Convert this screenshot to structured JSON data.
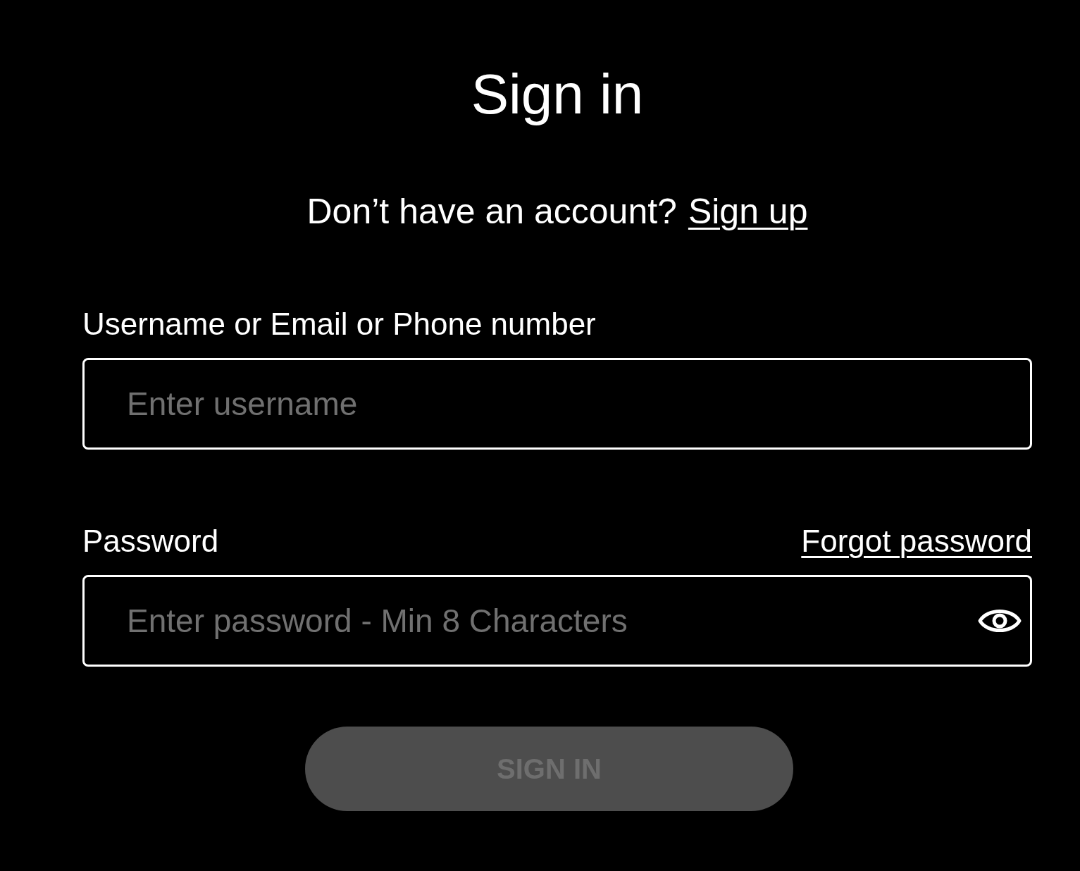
{
  "title": "Sign in",
  "signup_prompt": {
    "text": "Don’t have an account?",
    "link": "Sign up"
  },
  "username": {
    "label": "Username or Email or Phone number",
    "placeholder": "Enter username"
  },
  "password": {
    "label": "Password",
    "forgot_link": "Forgot password",
    "placeholder": "Enter password - Min 8 Characters"
  },
  "submit": {
    "label": "SIGN IN",
    "disabled": true
  }
}
